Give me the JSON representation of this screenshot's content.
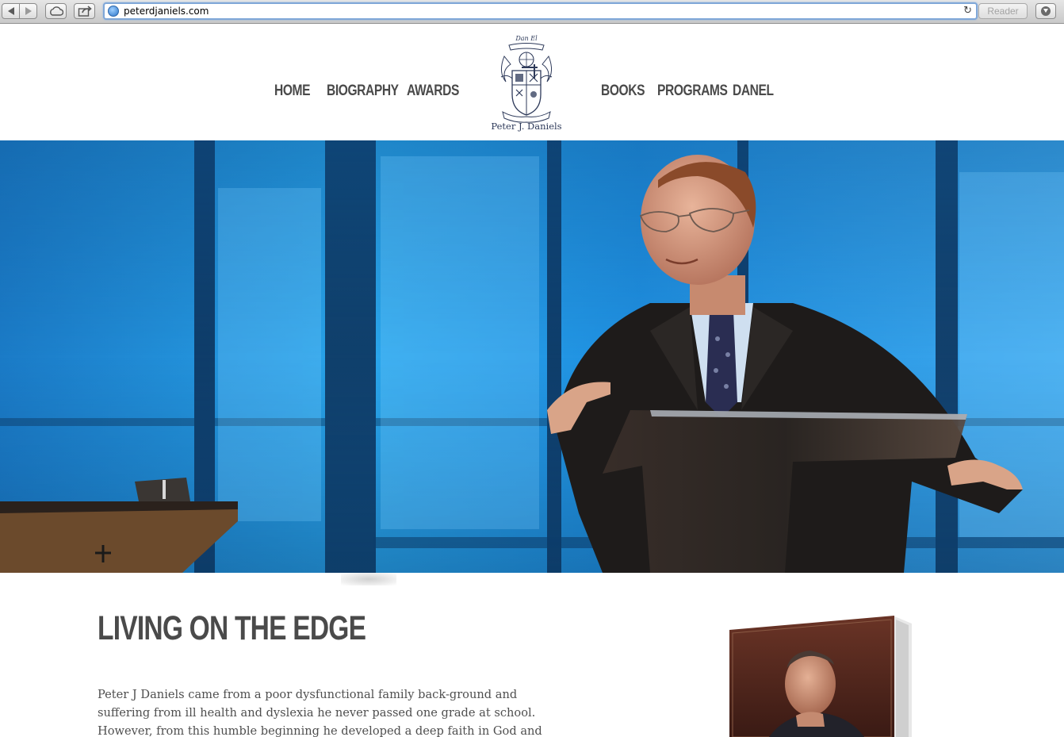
{
  "browser": {
    "url": "peterdjaniels.com",
    "reader_label": "Reader"
  },
  "nav": {
    "left": [
      "HOME",
      "BIOGRAPHY",
      "AWARDS"
    ],
    "right": [
      "BOOKS",
      "PROGRAMS",
      "DANEL"
    ]
  },
  "logo": {
    "motto": "Dan El",
    "caption": "Peter J. Daniels"
  },
  "hero": {
    "alt_colors": {
      "sky": "#1f8fe0",
      "suit": "#1e1b1a",
      "podium": "#2a2522"
    }
  },
  "content": {
    "title": "LIVING ON THE EDGE",
    "body": "Peter J Daniels came from a poor dysfunctional family back-ground and suffering from ill health and dyslexia he never passed one grade at school. However, from this humble beginning he developed a deep faith in God and confounded the"
  },
  "colors": {
    "nav_text": "#4a4a4a",
    "body_text": "#4f4f4f",
    "logo_blue": "#2e3a5a"
  }
}
